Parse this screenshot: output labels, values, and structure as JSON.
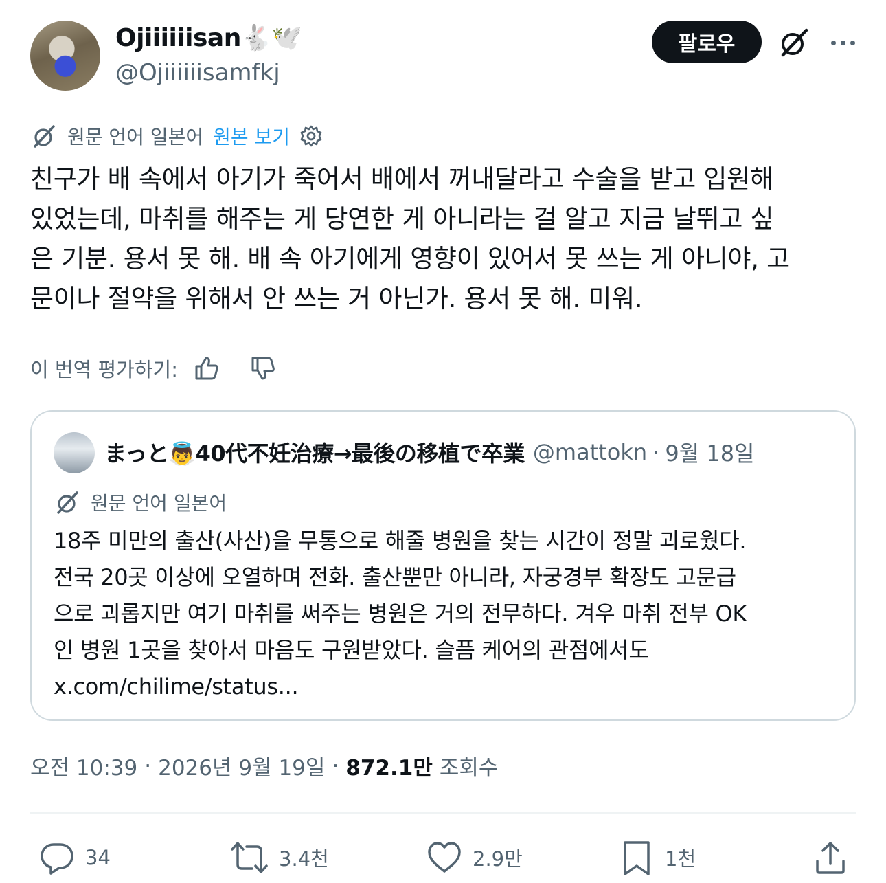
{
  "author": {
    "display_name": "Ojiiiiiisan🐇🕊️",
    "handle": "@Ojiiiiiisamfkj"
  },
  "header": {
    "follow_label": "팔로우"
  },
  "translation": {
    "source_language": "원문 언어 일본어",
    "show_original": "원본 보기"
  },
  "tweet": {
    "lines": [
      "친구가 배 속에서 아기가 죽어서 배에서 꺼내달라고 수술을 받고 입원해",
      "있었는데, 마취를 해주는 게 당연한 게 아니라는 걸 알고 지금 날뛰고 싶",
      "은 기분. 용서 못 해. 배 속 아기에게 영향이 있어서 못 쓰는 게 아니야, 고",
      "문이나 절약을 위해서 안 쓰는 거 아닌가. 용서 못 해. 미워."
    ]
  },
  "rating": {
    "label": "이 번역 평가하기:"
  },
  "quote": {
    "name": "まっと👼40代不妊治療→最後の移植で卒業",
    "handle": "@mattokn",
    "date": "9월 18일",
    "source_language": "원문 언어 일본어",
    "lines": [
      "18주 미만의 출산(사산)을 무통으로 해줄 병원을 찾는 시간이 정말 괴로웠다.",
      "전국 20곳 이상에 오열하며 전화. 출산뿐만 아니라, 자궁경부 확장도 고문급",
      "으로 괴롭지만 여기 마취를 써주는 병원은 거의 전무하다. 겨우 마취 전부 OK",
      "인 병원 1곳을 찾아서 마음도 구원받았다. 슬픔 케어의 관점에서도",
      "x.com/chilime/status..."
    ]
  },
  "meta": {
    "time": "오전 10:39",
    "date": "2026년 9월 19일",
    "views_count": "872.1만",
    "views_label": "조회수"
  },
  "actions": {
    "replies": "34",
    "reposts": "3.4천",
    "likes": "2.9만",
    "bookmarks": "1천"
  },
  "icons": [
    "grok-icon",
    "more-icon",
    "translate-icon",
    "settings-gear-icon",
    "thumbs-up-icon",
    "thumbs-down-icon",
    "reply-icon",
    "repost-icon",
    "like-icon",
    "bookmark-icon",
    "share-icon"
  ],
  "colors": {
    "text": "#0f1419",
    "secondary": "#536471",
    "link": "#1d9bf0",
    "border": "#cfd9de",
    "follow_bg": "#0f1419"
  }
}
